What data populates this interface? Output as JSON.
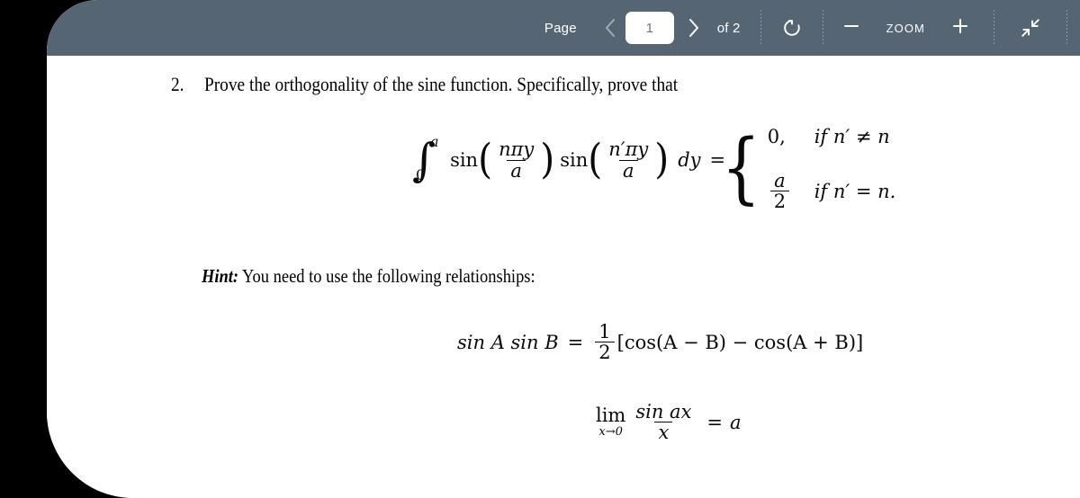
{
  "theme": {
    "toolbar_bg": "#566573",
    "page_bg": "#ffffff",
    "backdrop": "#000000",
    "toolbar_text": "#ffffff",
    "input_text": "#6b7680"
  },
  "toolbar": {
    "page_label": "Page",
    "prev_icon": "chevron-left-icon",
    "page_value": "1",
    "page_placeholder": "1",
    "next_icon": "chevron-right-icon",
    "of_label": "of 2",
    "total_pages": "2",
    "rotate_icon": "rotate-icon",
    "zoom_out_label": "−",
    "zoom_label": "ZOOM",
    "zoom_in_label": "+",
    "collapse_icon": "collapse-arrows-icon"
  },
  "document": {
    "problem": {
      "number": "2.",
      "text": "Prove the orthogonality of the sine function. Specifically, prove that"
    },
    "equation_integral": {
      "integral_symbol": "∫",
      "upper_limit": "a",
      "lower_limit": "0",
      "sin1": "sin",
      "sin1_num": "nπy",
      "sin1_den": "a",
      "sin2": "sin",
      "sin2_num": "n′πy",
      "sin2_den": "a",
      "differential": "dy",
      "equals": "="
    },
    "equation_piecewise": {
      "case1_value": "0,",
      "case1_condition": "if n′ ≠ n",
      "case2_num": "a",
      "case2_den": "2",
      "case2_condition": "if n′ = n."
    },
    "hint": {
      "label": "Hint:",
      "text": "You need to use the following relationships:"
    },
    "equation_identity": {
      "lhs": "sin A  sin B",
      "equals": "=",
      "frac_num": "1",
      "frac_den": "2",
      "rhs": "[cos(A − B) − cos(A + B)]"
    },
    "equation_limit": {
      "lim": "lim",
      "lim_sub": "x→0",
      "frac_num": "sin ax",
      "frac_den": "x",
      "equals": "=",
      "result": "a"
    }
  }
}
